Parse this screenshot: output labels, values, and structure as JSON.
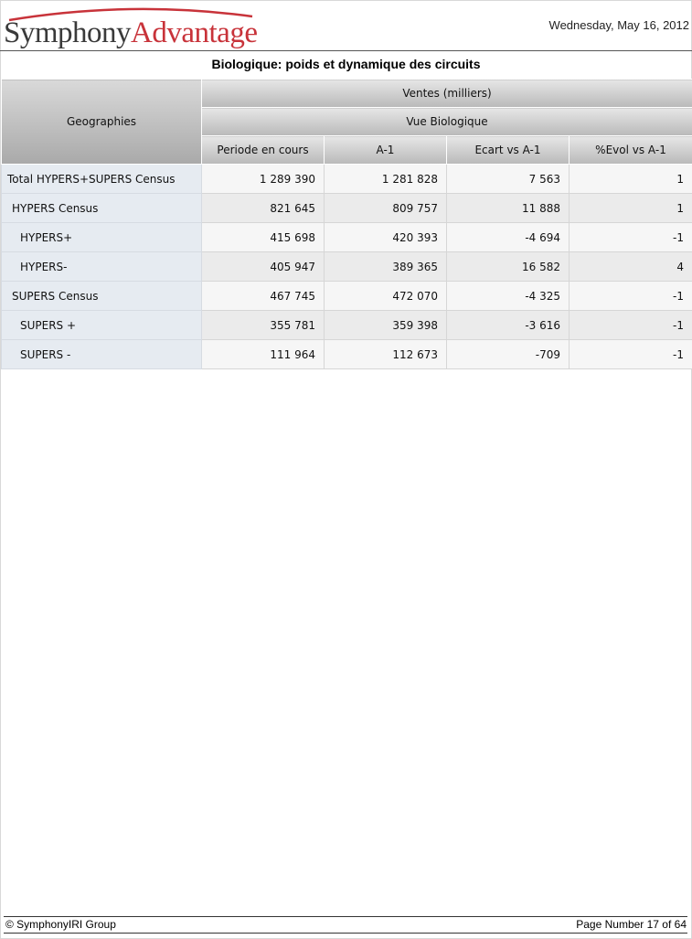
{
  "header": {
    "logo_part1": "Symphony",
    "logo_part2": "Advantage",
    "date": "Wednesday, May 16, 2012"
  },
  "report": {
    "title": "Biologique: poids et dynamique des circuits"
  },
  "table": {
    "row_header": "Geographies",
    "group_header": "Ventes (milliers)",
    "subgroup_header": "Vue Biologique",
    "columns": [
      "Periode en cours",
      "A-1",
      "Ecart vs A-1",
      "%Evol vs A-1"
    ],
    "rows": [
      {
        "label": "Total HYPERS+SUPERS Census",
        "level": 0,
        "values": [
          "1 289 390",
          "1 281 828",
          "7 563",
          "1"
        ]
      },
      {
        "label": "HYPERS Census",
        "level": 1,
        "values": [
          "821 645",
          "809 757",
          "11 888",
          "1"
        ]
      },
      {
        "label": "HYPERS+",
        "level": 2,
        "values": [
          "415 698",
          "420 393",
          "-4 694",
          "-1"
        ]
      },
      {
        "label": "HYPERS-",
        "level": 2,
        "values": [
          "405 947",
          "389 365",
          "16 582",
          "4"
        ]
      },
      {
        "label": "SUPERS Census",
        "level": 1,
        "values": [
          "467 745",
          "472 070",
          "-4 325",
          "-1"
        ]
      },
      {
        "label": "SUPERS +",
        "level": 2,
        "values": [
          "355 781",
          "359 398",
          "-3 616",
          "-1"
        ]
      },
      {
        "label": "SUPERS -",
        "level": 2,
        "values": [
          "111 964",
          "112 673",
          "-709",
          "-1"
        ]
      }
    ]
  },
  "footer": {
    "copyright": "© SymphonyIRI Group",
    "page_label": "Page Number 17 of 64"
  },
  "colors": {
    "logo_red": "#c8333a",
    "logo_gray": "#3a3a3a",
    "row_label_bg": "#e6ebf1",
    "header_bg": "#c4c4c4"
  }
}
